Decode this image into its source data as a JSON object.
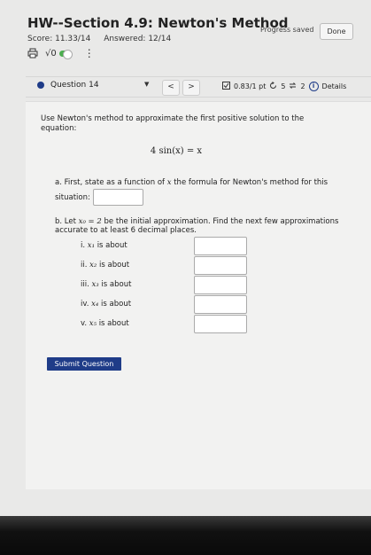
{
  "header": {
    "title": "HW--Section 4.9: Newton's Method",
    "progress_status": "Progress saved",
    "done_label": "Done",
    "score": "Score: 11.33/14",
    "answered": "Answered: 12/14"
  },
  "toolbar": {
    "sqrt_label": "√0",
    "more_label": "⋮"
  },
  "question_bar": {
    "question_label": "Question 14",
    "prev_label": "<",
    "next_label": ">",
    "points": "0.83/1 pt",
    "attempts": "5",
    "submissions": "2",
    "details_label": "Details"
  },
  "question": {
    "prompt": "Use Newton's method to approximate the first positive solution to the equation:",
    "equation": "4 sin(x) = x",
    "part_a": {
      "text_before": "a. First, state as a function of",
      "var": "x",
      "text_after": "the formula for Newton's method for this situation:"
    },
    "part_b": {
      "text_prefix": "b. Let",
      "initial": "x₀ = 2",
      "text_suffix": "be the initial approximation. Find the next few approximations accurate to at least 6 decimal places."
    },
    "sub_items": [
      {
        "numeral": "i.",
        "var": "x₁",
        "suffix": "is about"
      },
      {
        "numeral": "ii.",
        "var": "x₂",
        "suffix": "is about"
      },
      {
        "numeral": "iii.",
        "var": "x₃",
        "suffix": "is about"
      },
      {
        "numeral": "iv.",
        "var": "x₄",
        "suffix": "is about"
      },
      {
        "numeral": "v.",
        "var": "x₅",
        "suffix": "is about"
      }
    ],
    "submit_label": "Submit Question"
  }
}
